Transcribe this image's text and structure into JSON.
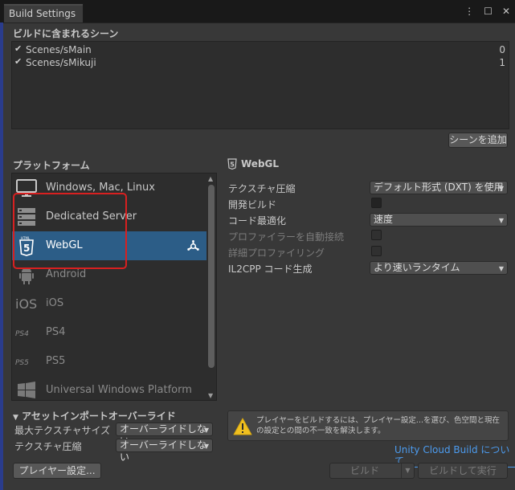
{
  "window": {
    "tab_title": "Build Settings",
    "title_icons": [
      "⋮",
      "☐",
      "✕"
    ]
  },
  "scenes": {
    "header": "ビルドに含まれるシーン",
    "items": [
      {
        "name": "Scenes/sMain",
        "index": "0",
        "checked": true
      },
      {
        "name": "Scenes/sMikuji",
        "index": "1",
        "checked": true
      }
    ],
    "add_button": "シーンを追加"
  },
  "platforms": {
    "header": "プラットフォーム",
    "items": [
      {
        "label": "Windows, Mac, Linux",
        "icon": "monitor-icon",
        "dim": false
      },
      {
        "label": "Dedicated Server",
        "icon": "server-icon",
        "dim": false
      },
      {
        "label": "WebGL",
        "icon": "html5-icon",
        "dim": false,
        "selected": true
      },
      {
        "label": "Android",
        "icon": "android-icon",
        "dim": true
      },
      {
        "label": "iOS",
        "icon": "ios-icon",
        "dim": true
      },
      {
        "label": "PS4",
        "icon": "ps4-icon",
        "dim": true
      },
      {
        "label": "PS5",
        "icon": "ps5-icon",
        "dim": true
      },
      {
        "label": "Universal Windows Platform",
        "icon": "windows-logo-icon",
        "dim": true
      }
    ]
  },
  "settings": {
    "title": "WebGL",
    "texture_compression_label": "テクスチャ圧縮",
    "texture_compression_value": "デフォルト形式 (DXT) を使用",
    "dev_build_label": "開発ビルド",
    "code_opt_label": "コード最適化",
    "code_opt_value": "速度",
    "autoconnect_profiler_label": "プロファイラーを自動接続",
    "deep_profiling_label": "詳細プロファイリング",
    "il2cpp_label": "IL2CPP コード生成",
    "il2cpp_value": "より速いランタイム"
  },
  "overrides": {
    "header": "アセットインポートオーバーライド",
    "max_texture_label": "最大テクスチャサイズ",
    "max_texture_value": "オーバーライドしない",
    "texture_compression_label": "テクスチャ圧縮",
    "texture_compression_value": "オーバーライドしない"
  },
  "warning": {
    "text": "プレイヤーをビルドするには、プレイヤー設定...を選び、色空間と現在の設定との間の不一致を解決します。"
  },
  "cloud_build_link": "Unity Cloud Build について",
  "buttons": {
    "player_settings": "プレイヤー設定...",
    "build": "ビルド",
    "build_and_run": "ビルドして実行"
  },
  "colors": {
    "selected": "#2c5d87",
    "highlight": "#d82020",
    "link": "#4c9cf0"
  }
}
